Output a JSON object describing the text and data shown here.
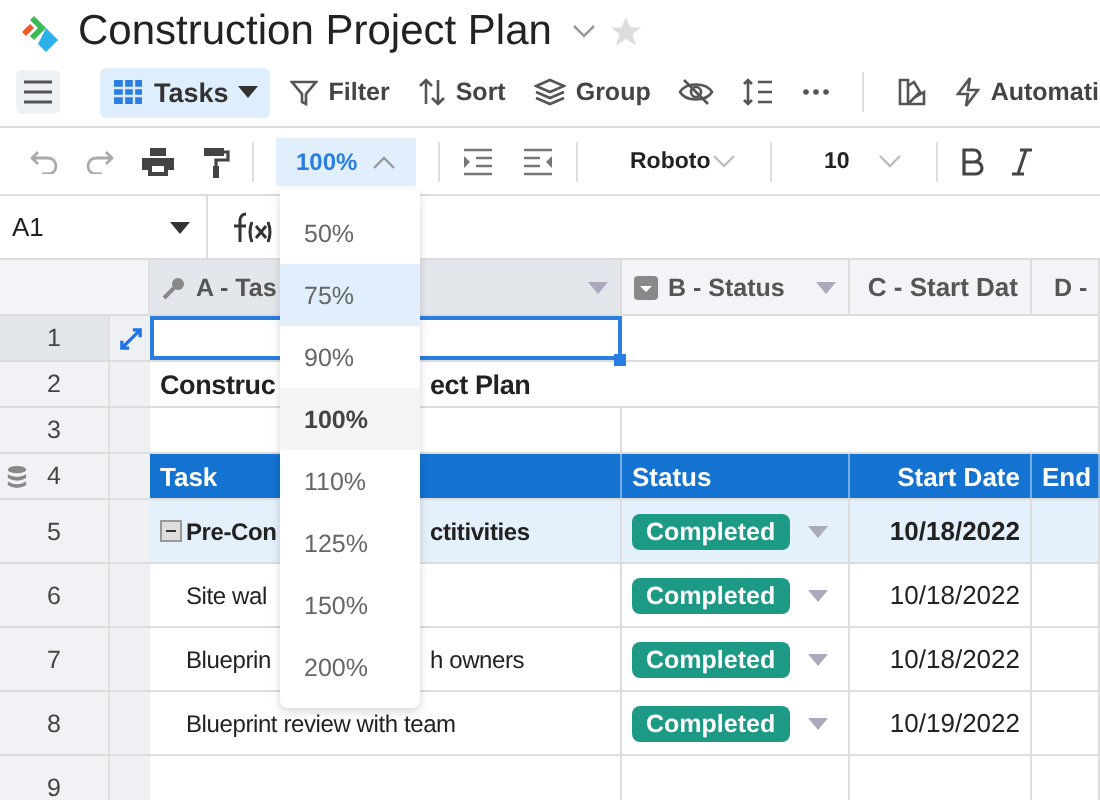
{
  "app": {
    "title": "Construction Project Plan",
    "starred": false
  },
  "toolbar": {
    "view": "Tasks",
    "buttons": [
      {
        "kind": "filter",
        "label": "Filter"
      },
      {
        "kind": "sort",
        "label": "Sort"
      },
      {
        "kind": "group",
        "label": "Group"
      },
      {
        "kind": "hide"
      },
      {
        "kind": "rowheight"
      },
      {
        "kind": "more"
      },
      {
        "kind": "colorize"
      },
      {
        "kind": "automation",
        "label": "Automati"
      }
    ]
  },
  "format_bar": {
    "zoom": "100%",
    "font": "Roboto",
    "size": "10"
  },
  "zoom_menu": {
    "expanded": true,
    "options": [
      {
        "label": "50%",
        "selected": false,
        "hovered": false
      },
      {
        "label": "75%",
        "selected": false,
        "hovered": true
      },
      {
        "label": "90%",
        "selected": false,
        "hovered": false
      },
      {
        "label": "100%",
        "selected": true,
        "hovered": false
      },
      {
        "label": "110%",
        "selected": false,
        "hovered": false
      },
      {
        "label": "125%",
        "selected": false,
        "hovered": false
      },
      {
        "label": "150%",
        "selected": false,
        "hovered": false
      },
      {
        "label": "200%",
        "selected": false,
        "hovered": false
      }
    ]
  },
  "cell_ref": "A1",
  "columns": [
    {
      "kind": "key",
      "label": "A - Tas"
    },
    {
      "kind": "select",
      "label": "B - Status"
    },
    {
      "kind": "date",
      "label": "C - Start Dat"
    },
    {
      "kind": "date",
      "label": "D -"
    }
  ],
  "rows": [
    {
      "number": "1",
      "kind": "blank",
      "selected": true
    },
    {
      "number": "2",
      "kind": "title",
      "task": [
        "Construc",
        "ect Plan"
      ],
      "selected": false
    },
    {
      "number": "3",
      "kind": "blank",
      "selected": false
    },
    {
      "number": "4",
      "kind": "header",
      "cells": [
        "Task",
        "Status",
        "Start Date",
        "End"
      ],
      "selected": false
    },
    {
      "number": "5",
      "kind": "group",
      "task": [
        "Pre-Con",
        "ctitivities"
      ],
      "status": "Completed",
      "start": "10/18/2022",
      "selected": false
    },
    {
      "number": "6",
      "kind": "task",
      "task": [
        "Site wal"
      ],
      "status": "Completed",
      "start": "10/18/2022",
      "selected": false
    },
    {
      "number": "7",
      "kind": "task",
      "task": [
        "Blueprin",
        "h owners"
      ],
      "status": "Completed",
      "start": "10/18/2022",
      "selected": false
    },
    {
      "number": "8",
      "kind": "task",
      "task": [
        "Blueprint review with team"
      ],
      "status": "Completed",
      "start": "10/19/2022",
      "selected": false
    },
    {
      "number": "9",
      "kind": "cutoff",
      "selected": false
    }
  ]
}
